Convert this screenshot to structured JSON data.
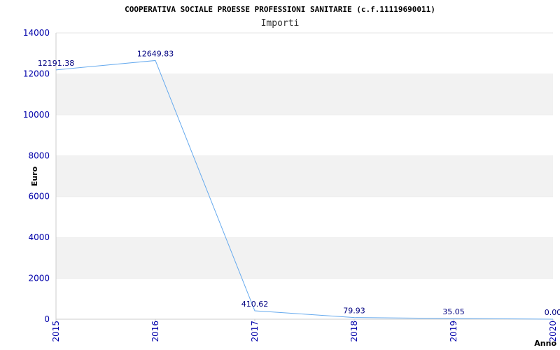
{
  "chart_data": {
    "type": "line",
    "title": "COOPERATIVA SOCIALE PROESSE PROFESSIONI SANITARIE (c.f.11119690011)",
    "subtitle": "Importi",
    "xlabel": "Anno",
    "ylabel": "Euro",
    "categories": [
      "2015",
      "2016",
      "2017",
      "2018",
      "2019",
      "2020"
    ],
    "series": [
      {
        "values": [
          12191.38,
          12649.83,
          410.62,
          79.93,
          35.05,
          0.0
        ],
        "labels": [
          "12191.38",
          "12649.83",
          "410.62",
          "79.93",
          "35.05",
          "0.00"
        ],
        "color": "#66aaee"
      }
    ],
    "ylim": [
      0,
      14000
    ],
    "yticks": [
      0,
      2000,
      4000,
      6000,
      8000,
      10000,
      12000,
      14000
    ],
    "grid": "alternating horizontal bands",
    "band_color": "#f2f2f2",
    "tick_color": "#0000aa",
    "label_color": "#000080"
  }
}
